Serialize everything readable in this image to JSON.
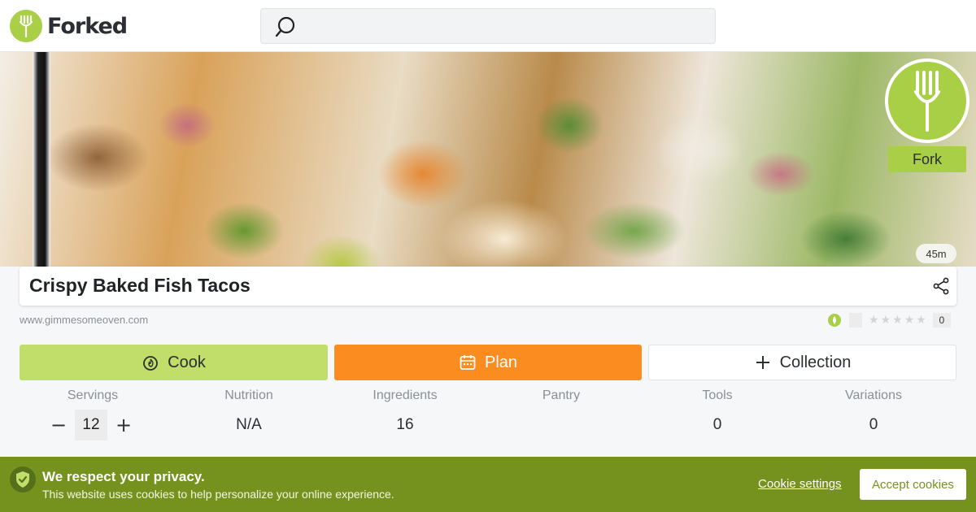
{
  "header": {
    "logo_text": "Forked",
    "search_placeholder": ""
  },
  "hero": {
    "fork_label": "Fork",
    "time": "45m"
  },
  "recipe": {
    "title": "Crispy Baked Fish Tacos",
    "source": "www.gimmesomeoven.com",
    "rating_count": "0",
    "stars": "★★★★★"
  },
  "actions": {
    "cook": "Cook",
    "plan": "Plan",
    "collection": "Collection"
  },
  "stats": {
    "servings_label": "Servings",
    "servings_value": "12",
    "nutrition_label": "Nutrition",
    "nutrition_value": "N/A",
    "ingredients_label": "Ingredients",
    "ingredients_value": "16",
    "pantry_label": "Pantry",
    "pantry_value": "",
    "tools_label": "Tools",
    "tools_value": "0",
    "variations_label": "Variations",
    "variations_value": "0",
    "minus": "−",
    "plus": "+"
  },
  "cookie": {
    "title": "We respect your privacy.",
    "text": "This website uses cookies to help personalize your online experience.",
    "settings": "Cookie settings",
    "accept": "Accept cookies"
  },
  "colors": {
    "brand_green": "#a8cf45",
    "cook_green": "#c1de6a",
    "plan_orange": "#fb8c1f",
    "cookie_bar": "#76921e"
  }
}
